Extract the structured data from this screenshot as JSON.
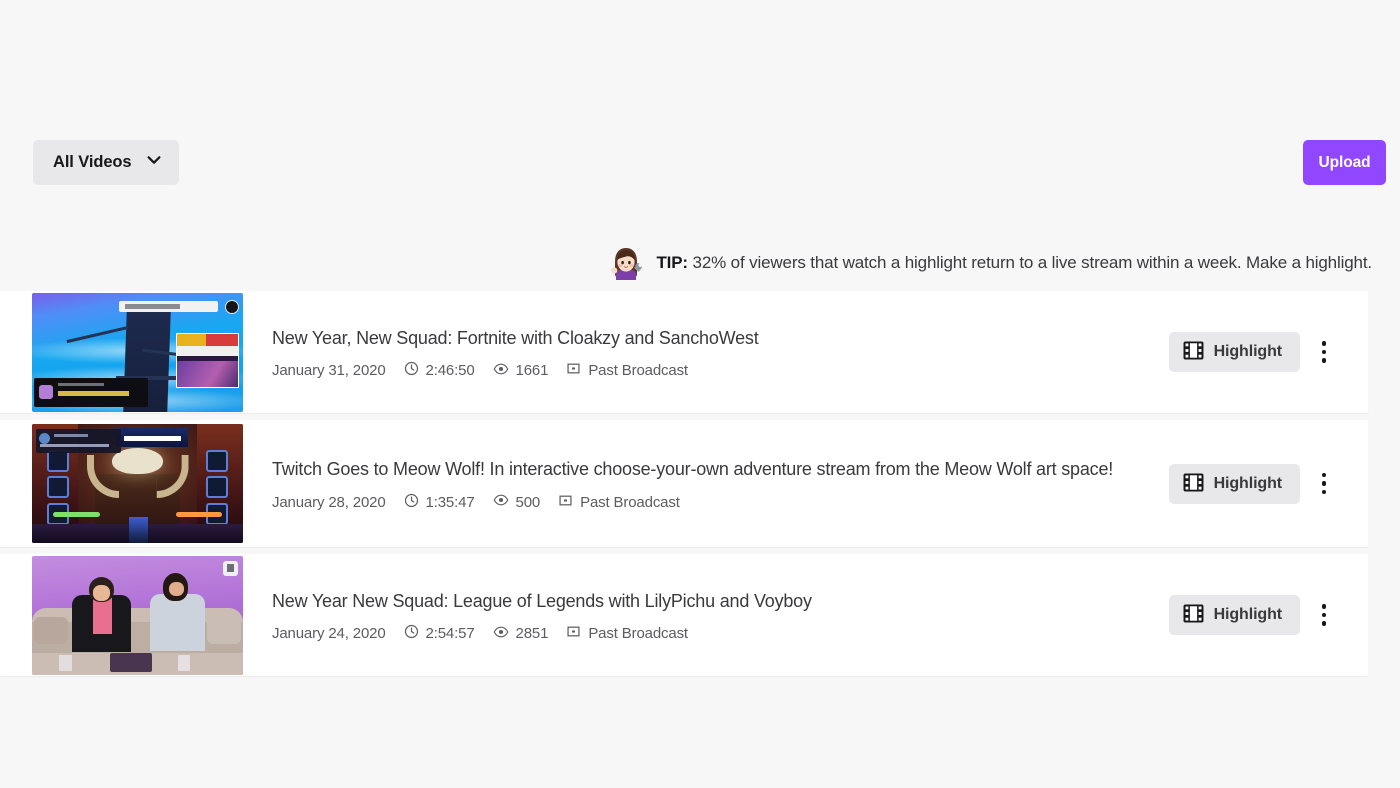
{
  "toolbar": {
    "filter_label": "All Videos",
    "filter_icon": "chevron-down-icon",
    "upload_label": "Upload",
    "accent_color": "#9147ff"
  },
  "tip": {
    "avatar_icon": "woman-mechanic-avatar",
    "prefix": "TIP:",
    "text": " 32% of viewers that watch a highlight return to a live stream within a week. Make a highlight."
  },
  "videos": [
    {
      "title": "New Year, New Squad: Fortnite with Cloakzy and SanchoWest",
      "date": "January 31, 2020",
      "duration": "2:46:50",
      "views": "1661",
      "type": "Past Broadcast",
      "highlight_label": "Highlight",
      "thumbnail": "fortnite-stream-thumbnail"
    },
    {
      "title": "Twitch Goes to Meow Wolf! In interactive choose-your-own adventure stream from the Meow Wolf art space!",
      "date": "January 28, 2020",
      "duration": "1:35:47",
      "views": "500",
      "type": "Past Broadcast",
      "highlight_label": "Highlight",
      "thumbnail": "meow-wolf-stream-thumbnail"
    },
    {
      "title": "New Year New Squad: League of Legends with LilyPichu and Voyboy",
      "date": "January 24, 2020",
      "duration": "2:54:57",
      "views": "2851",
      "type": "Past Broadcast",
      "highlight_label": "Highlight",
      "thumbnail": "league-couch-stream-thumbnail"
    }
  ]
}
